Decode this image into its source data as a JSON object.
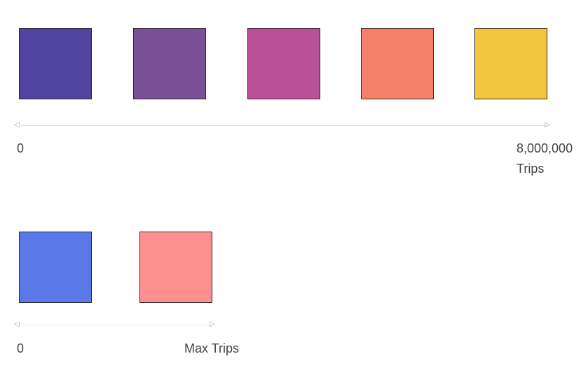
{
  "legend_top": {
    "colors": [
      "#5143a0",
      "#7a5196",
      "#bb5097",
      "#f38068",
      "#f3c63e"
    ],
    "min_label": "0",
    "max_label": "8,000,000",
    "unit_label": "Trips",
    "left_arrow": "◁",
    "right_arrow": "▷"
  },
  "legend_bottom": {
    "colors": [
      "#5a78e8",
      "#fe8f8f"
    ],
    "min_label": "0",
    "max_label": "Max Trips",
    "left_arrow": "◁",
    "right_arrow": "▷"
  }
}
